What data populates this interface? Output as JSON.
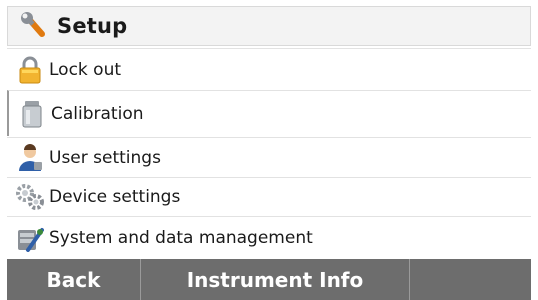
{
  "header": {
    "title": "Setup",
    "icon": "wrench-icon"
  },
  "menu": {
    "items": [
      {
        "label": "Lock out",
        "icon": "padlock-icon"
      },
      {
        "label": "Calibration",
        "icon": "calibration-weight-icon"
      },
      {
        "label": "User settings",
        "icon": "user-icon"
      },
      {
        "label": "Device settings",
        "icon": "gears-icon"
      },
      {
        "label": "System and data management",
        "icon": "system-tools-icon"
      }
    ]
  },
  "footer": {
    "softkeys": [
      {
        "label": "Back"
      },
      {
        "label": "Instrument Info"
      },
      {
        "label": ""
      }
    ]
  },
  "colors": {
    "footer_bg": "#6d6d6d",
    "header_bg": "#f3f3f3"
  }
}
